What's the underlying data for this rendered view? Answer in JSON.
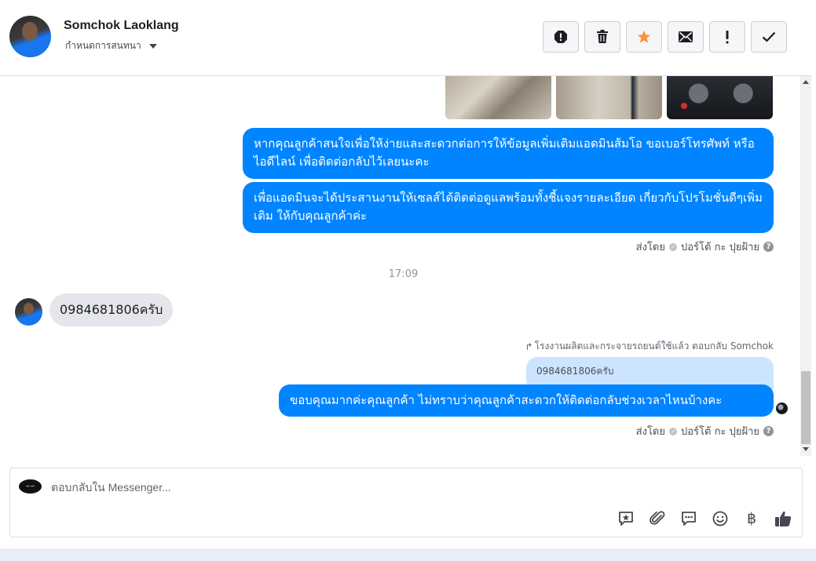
{
  "header": {
    "contact_name": "Somchok Laoklang",
    "assign_label": "กำหนดการสนทนา",
    "actions": [
      {
        "name": "spam-button",
        "icon": "alert-octagon-icon"
      },
      {
        "name": "delete-button",
        "icon": "trash-icon"
      },
      {
        "name": "star-button",
        "icon": "star-icon"
      },
      {
        "name": "mark-unread-button",
        "icon": "envelope-icon"
      },
      {
        "name": "flag-button",
        "icon": "exclamation-icon"
      },
      {
        "name": "mark-done-button",
        "icon": "checkmark-icon"
      }
    ],
    "star_color": "#f7923b"
  },
  "conversation": {
    "messages_out": [
      "หากคุณลูกค้าสนใจเพื่อให้ง่ายและสะดวกต่อการให้ข้อมูลเพิ่มเติมแอดมินส้มโอ ขอเบอร์โทรศัพท์ หรือ ไอดีไลน์ เพื่อติดต่อกลับไว้เลยนะคะ",
      "เพื่อแอดมินจะได้ประสานงานให้เซลส์ได้ติดต่อดูแลพร้อมทั้งชี้แจงรายละเอียด เกี่ยวกับโปรโมชั่นดีๆเพิ่มเติม ให้กับคุณลูกค้าค่ะ"
    ],
    "sent_by_1": "ส่งโดย",
    "sender_1": "ปอร์โต้ กะ ปุยฝ้าย",
    "timestamp": "17:09",
    "message_in": "0984681806ครับ",
    "reply_note": "โรงงานผลิตและกระจายรถยนต์ใช้แล้ว ตอบกลับ Somchok",
    "quoted_text": "0984681806ครับ",
    "reply_message": "ขอบคุณมากค่ะคุณลูกค้า ไม่ทราบว่าคุณลูกค้าสะดวกให้ติดต่อกลับช่วงเวลาไหนบ้างคะ",
    "sent_by_2": "ส่งโดย",
    "sender_2": "ปอร์โต้ กะ ปุยฝ้าย",
    "bubble_color": "#0084ff"
  },
  "composer": {
    "placeholder": "ตอบกลับใน Messenger...",
    "tools": [
      "saved-replies-icon",
      "attachment-icon",
      "chat-bubble-icon",
      "emoji-icon",
      "baht-icon",
      "thumbs-up-icon"
    ],
    "currency_glyph": "฿"
  }
}
